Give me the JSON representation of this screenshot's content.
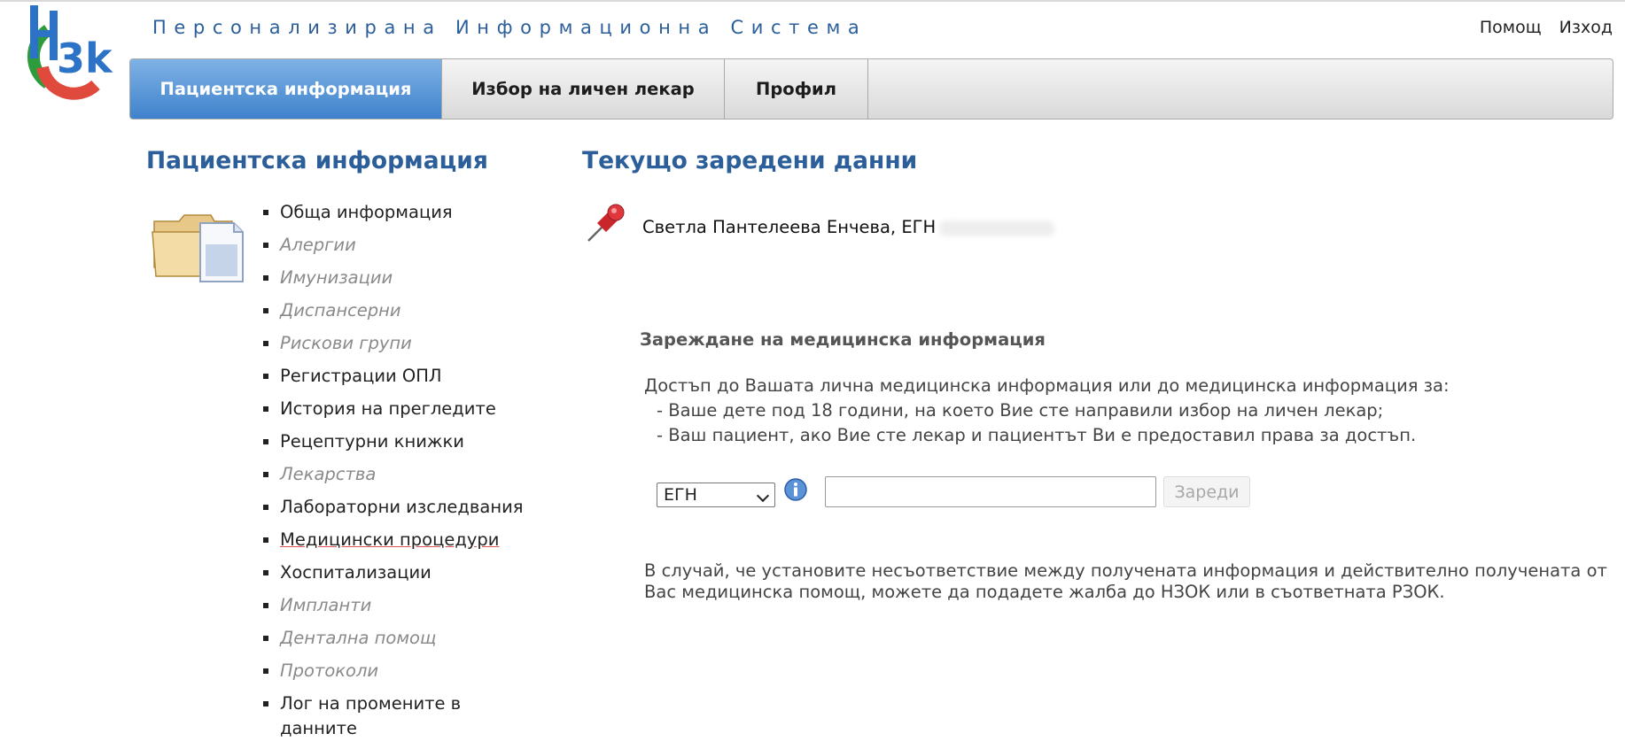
{
  "header": {
    "system_title": "Персонализирана Информационна Система",
    "help": "Помощ",
    "logout": "Изход",
    "logo_alt": "НЗОК"
  },
  "tabs": [
    {
      "label": "Пациентска информация",
      "active": true
    },
    {
      "label": "Избор на личен лекар",
      "active": false
    },
    {
      "label": "Профил",
      "active": false
    }
  ],
  "sidebar": {
    "title": "Пациентска информация",
    "items": [
      {
        "label": "Обща информация",
        "enabled": true
      },
      {
        "label": "Алергии",
        "enabled": false
      },
      {
        "label": "Имунизации",
        "enabled": false
      },
      {
        "label": "Диспансерни",
        "enabled": false
      },
      {
        "label": "Рискови групи",
        "enabled": false
      },
      {
        "label": "Регистрации ОПЛ",
        "enabled": true
      },
      {
        "label": "История на прегледите",
        "enabled": true
      },
      {
        "label": "Рецептурни книжки",
        "enabled": true
      },
      {
        "label": "Лекарства",
        "enabled": false
      },
      {
        "label": "Лабораторни изследвания",
        "enabled": true
      },
      {
        "label": "Медицински процедури",
        "enabled": true
      },
      {
        "label": "Хоспитализации",
        "enabled": true
      },
      {
        "label": "Импланти",
        "enabled": false
      },
      {
        "label": "Дентална помощ",
        "enabled": false
      },
      {
        "label": "Протоколи",
        "enabled": false
      },
      {
        "label": "Лог на промените в данните",
        "enabled": true
      }
    ]
  },
  "main": {
    "title": "Текущо заредени данни",
    "patient_line": "Светла Пантелеева Енчева, ЕГН",
    "load_section_title": "Зареждане на медицинска информация",
    "access_intro": "Достъп до Вашата лична медицинска информация или до медицинска информация за:",
    "access_items": [
      "-  Ваше дете под 18 години, на което Вие сте направили избор на личен лекар;",
      "-  Ваш пациент, ако Вие сте лекар и пациентът Ви е предоставил права за достъп."
    ],
    "id_type_selected": "ЕГН",
    "id_input_value": "",
    "load_button": "Зареди",
    "complaint_text": "В случай, че установите несъответствие между получената информация и действително получената от Вас медицинска помощ, можете да подадете жалба до НЗОК или в съответната РЗОК."
  }
}
